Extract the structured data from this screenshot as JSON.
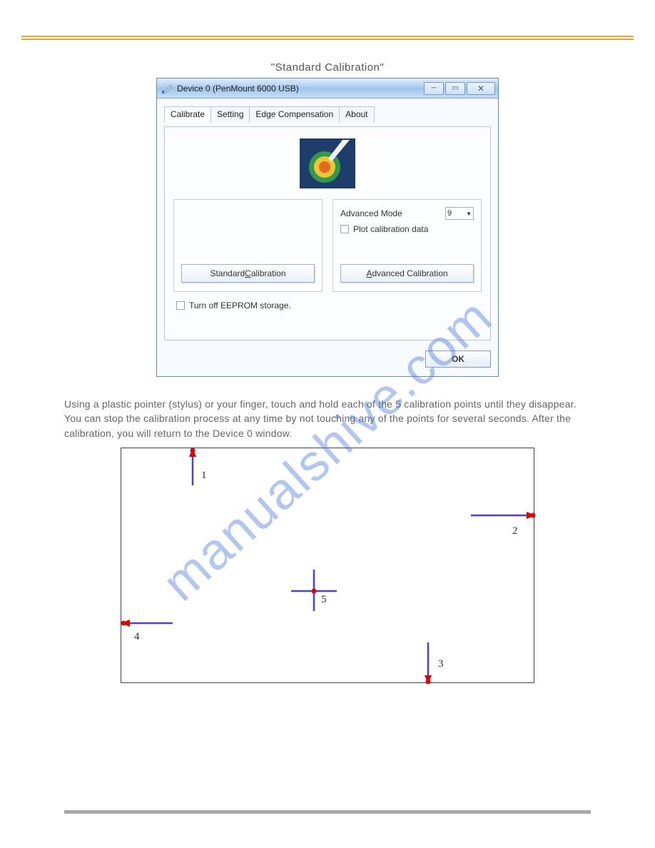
{
  "caption": "\"Standard Calibration\"",
  "window": {
    "title": "Device 0 (PenMount 6000 USB)",
    "tabs": [
      "Calibrate",
      "Setting",
      "Edge Compensation",
      "About"
    ],
    "active_tab": 0,
    "advanced_mode_label": "Advanced Mode",
    "advanced_mode_value": "9",
    "plot_label": "Plot calibration data",
    "std_btn_pre": "Standard ",
    "std_btn_u": "C",
    "std_btn_post": "alibration",
    "adv_btn_u": "A",
    "adv_btn_post": "dvanced Calibration",
    "eeprom_label": "Turn off EEPROM storage.",
    "ok_label": "OK"
  },
  "paragraph": "Using a plastic pointer (stylus) or your finger, touch and hold each of the 5 calibration points until they disappear.  You can stop the calibration process at any time by not touching any of the points for several seconds.  After the calibration, you will return to the Device 0 window.",
  "diagram": {
    "points": {
      "p1": "1",
      "p2": "2",
      "p3": "3",
      "p4": "4",
      "p5": "5"
    }
  },
  "watermark": "manualshive.com"
}
